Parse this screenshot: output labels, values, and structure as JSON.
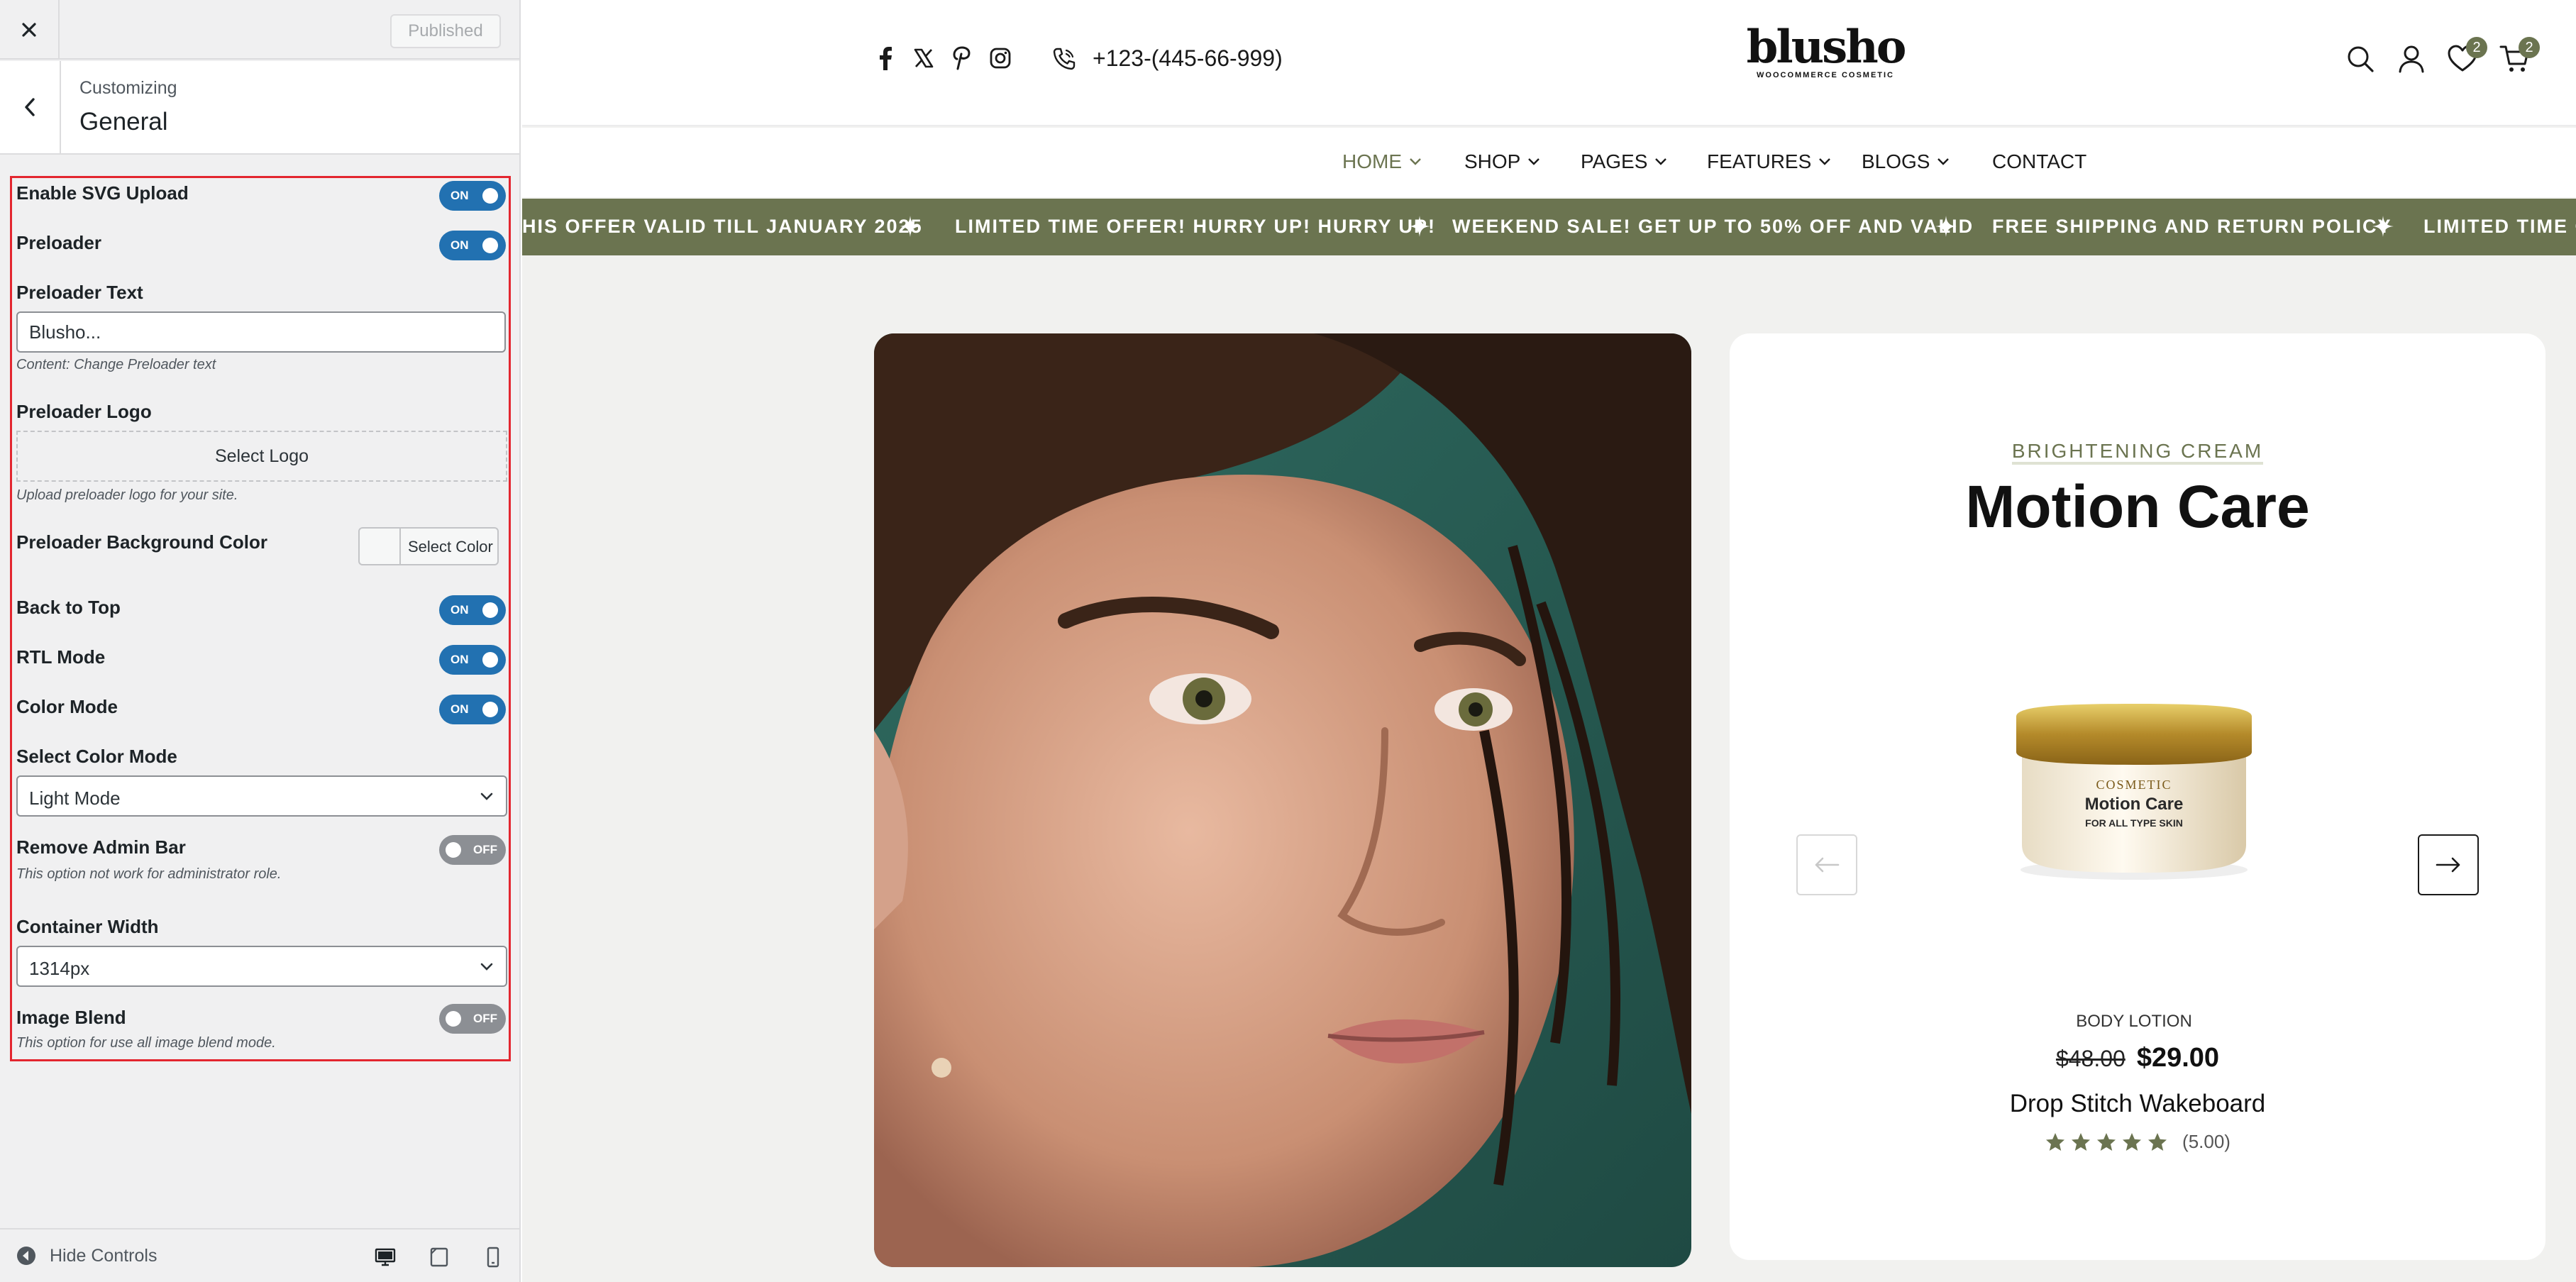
{
  "sidebar": {
    "published_label": "Published",
    "customizing_label": "Customizing",
    "section_title": "General",
    "controls": {
      "enable_svg_upload": {
        "label": "Enable SVG Upload",
        "state": "ON"
      },
      "preloader": {
        "label": "Preloader",
        "state": "ON"
      },
      "preloader_text": {
        "label": "Preloader Text",
        "value": "Blusho...",
        "description": "Content: Change Preloader text"
      },
      "preloader_logo": {
        "label": "Preloader Logo",
        "button": "Select Logo",
        "description": "Upload preloader logo for your site."
      },
      "preloader_bg_color": {
        "label": "Preloader Background Color",
        "button": "Select Color"
      },
      "back_to_top": {
        "label": "Back to Top",
        "state": "ON"
      },
      "rtl_mode": {
        "label": "RTL Mode",
        "state": "ON"
      },
      "color_mode": {
        "label": "Color Mode",
        "state": "ON"
      },
      "select_color_mode": {
        "label": "Select Color Mode",
        "value": "Light Mode"
      },
      "remove_admin_bar": {
        "label": "Remove Admin Bar",
        "state": "OFF",
        "description": "This option not work for administrator role."
      },
      "container_width": {
        "label": "Container Width",
        "value": "1314px"
      },
      "image_blend": {
        "label": "Image Blend",
        "state": "OFF",
        "description": "This option for use all image blend mode."
      }
    },
    "footer": {
      "hide_controls": "Hide Controls"
    }
  },
  "site": {
    "phone": "+123-(445-66-999)",
    "logo": {
      "brand": "blusho",
      "tagline": "WOOCOMMERCE COSMETIC"
    },
    "wishlist_count": "2",
    "cart_count": "2",
    "nav": [
      "HOME",
      "SHOP",
      "PAGES",
      "FEATURES",
      "BLOGS",
      "CONTACT"
    ],
    "marquee": [
      "HIS OFFER VALID TILL JANUARY 2025",
      "LIMITED TIME OFFER! HURRY UP! HURRY UP!",
      "WEEKEND SALE! GET UP TO 50% OFF AND VALID",
      "FREE SHIPPING AND RETURN POLICY",
      "LIMITED TIME OF"
    ],
    "hero": {
      "eyebrow": "BRIGHTENING CREAM",
      "headline": "Motion Care",
      "jar": {
        "line1": "COSMETIC",
        "line2": "Motion Care",
        "line3": "FOR ALL TYPE SKIN"
      },
      "category": "BODY LOTION",
      "old_price": "$48.00",
      "new_price": "$29.00",
      "product_name": "Drop Stitch Wakeboard",
      "rating_stars": 5,
      "rating_text": "(5.00)"
    }
  },
  "colors": {
    "accent": "#6b7450",
    "toggle_on": "#2271b1",
    "toggle_off": "#8c8f94",
    "highlight_border": "#e3262f"
  },
  "icons": [
    "close-icon",
    "chevron-left-icon",
    "facebook-icon",
    "x-icon",
    "pinterest-icon",
    "instagram-icon",
    "phone-icon",
    "search-icon",
    "user-icon",
    "heart-icon",
    "cart-icon",
    "chevron-down-icon",
    "sparkle-icon",
    "arrow-left-icon",
    "arrow-right-icon",
    "star-icon",
    "desktop-icon",
    "tablet-icon",
    "mobile-icon"
  ]
}
